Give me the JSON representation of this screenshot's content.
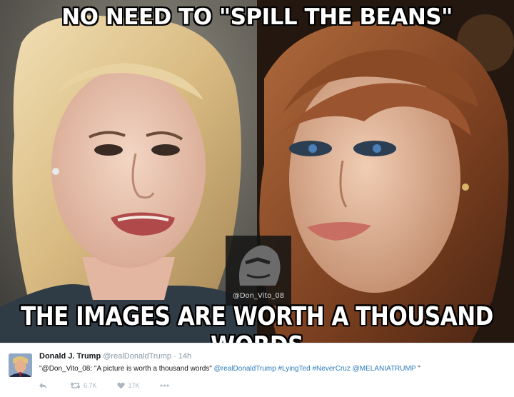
{
  "meme": {
    "top_caption": "NO NEED TO \"SPILL THE BEANS\"",
    "bottom_caption": "THE IMAGES ARE WORTH A THOUSAND WORDS",
    "watermark": "@Don_Vito_08"
  },
  "tweet": {
    "author_name": "Donald J. Trump",
    "handle": "@realDonaldTrump",
    "separator": "·",
    "time": "14h",
    "text_quote": "\"@Don_Vito_08: \"A picture is worth a thousand words\"",
    "mention": "@realDonaldTrump",
    "hashtag_1": "#LyingTed",
    "hashtag_2": "#NeverCruz",
    "mention_2": "@MELANIATRUMP",
    "text_end": "\"",
    "retweet_count": "6.7K",
    "like_count": "17K",
    "icons": [
      "reply-icon",
      "retweet-icon",
      "like-icon",
      "more-icon"
    ]
  }
}
